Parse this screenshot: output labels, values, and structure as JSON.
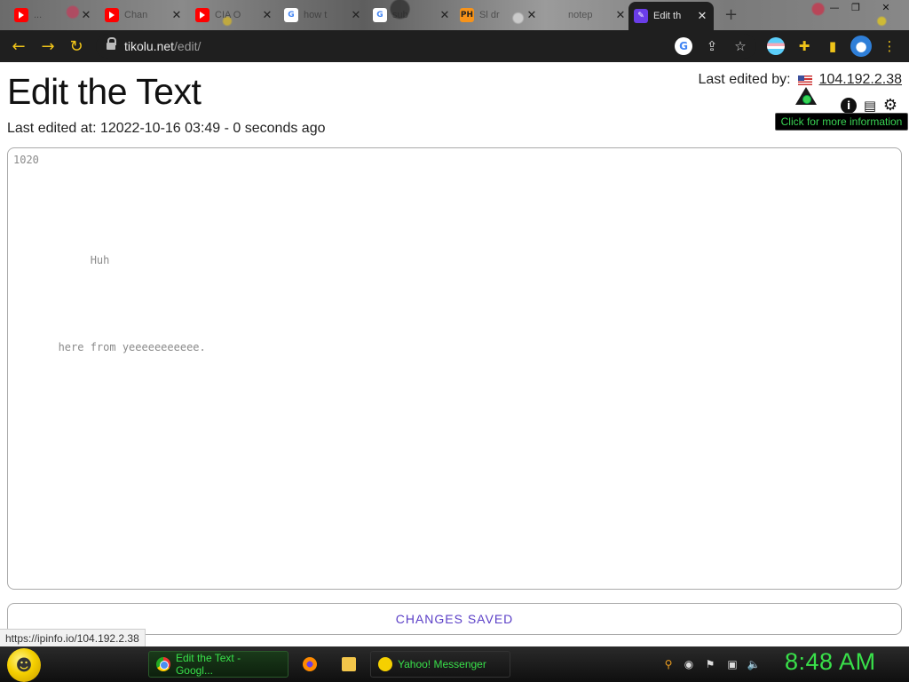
{
  "browser": {
    "tabs": [
      {
        "title": "...",
        "favicon": "youtube-icon"
      },
      {
        "title": "Chan",
        "favicon": "youtube-icon"
      },
      {
        "title": "CIA O",
        "favicon": "youtube-icon"
      },
      {
        "title": "how t",
        "favicon": "google-icon"
      },
      {
        "title": "sub",
        "favicon": "google-icon"
      },
      {
        "title": "Sl dr",
        "favicon": "ph-icon"
      },
      {
        "title": "notep",
        "favicon": "page-icon"
      },
      {
        "title": "Edit th",
        "favicon": "edit-icon"
      }
    ],
    "new_tab": "+",
    "url_host": "tikolu.net",
    "url_path": "/edit/",
    "tab_favicon_labels": {
      "ph": "PH",
      "google": "G"
    },
    "colors": {
      "toolbar": "#1f1f1f",
      "nav_icons": "#f0c419"
    }
  },
  "page": {
    "title": "Edit the Text",
    "last_edited_at": "Last edited at: 12022-10-16  03:49 - 0 seconds ago",
    "last_edited_by_label": "Last edited by:",
    "last_edited_by_ip": "104.192.2.38",
    "tooltip": "Click for more information",
    "editor_text": "1020\n\n\n\n\n\n\n\n            Huh\n\n\n\n\n\n\n       here from yeeeeeeeeeee.",
    "save_status": "CHANGES SAVED",
    "hover_url": "https://ipinfo.io/104.192.2.38",
    "colors": {
      "accent": "#5b3fc7",
      "tooltip_text": "#39d353"
    }
  },
  "taskbar": {
    "items": [
      {
        "label": "Edit the Text - Googl...",
        "icon": "chrome-icon"
      },
      {
        "label": "",
        "icon": "firefox-icon"
      },
      {
        "label": "",
        "icon": "folder-icon"
      },
      {
        "label": "Yahoo! Messenger",
        "icon": "yahoo-messenger-icon"
      }
    ],
    "clock": "8:48 AM",
    "color": "#39e04a"
  }
}
